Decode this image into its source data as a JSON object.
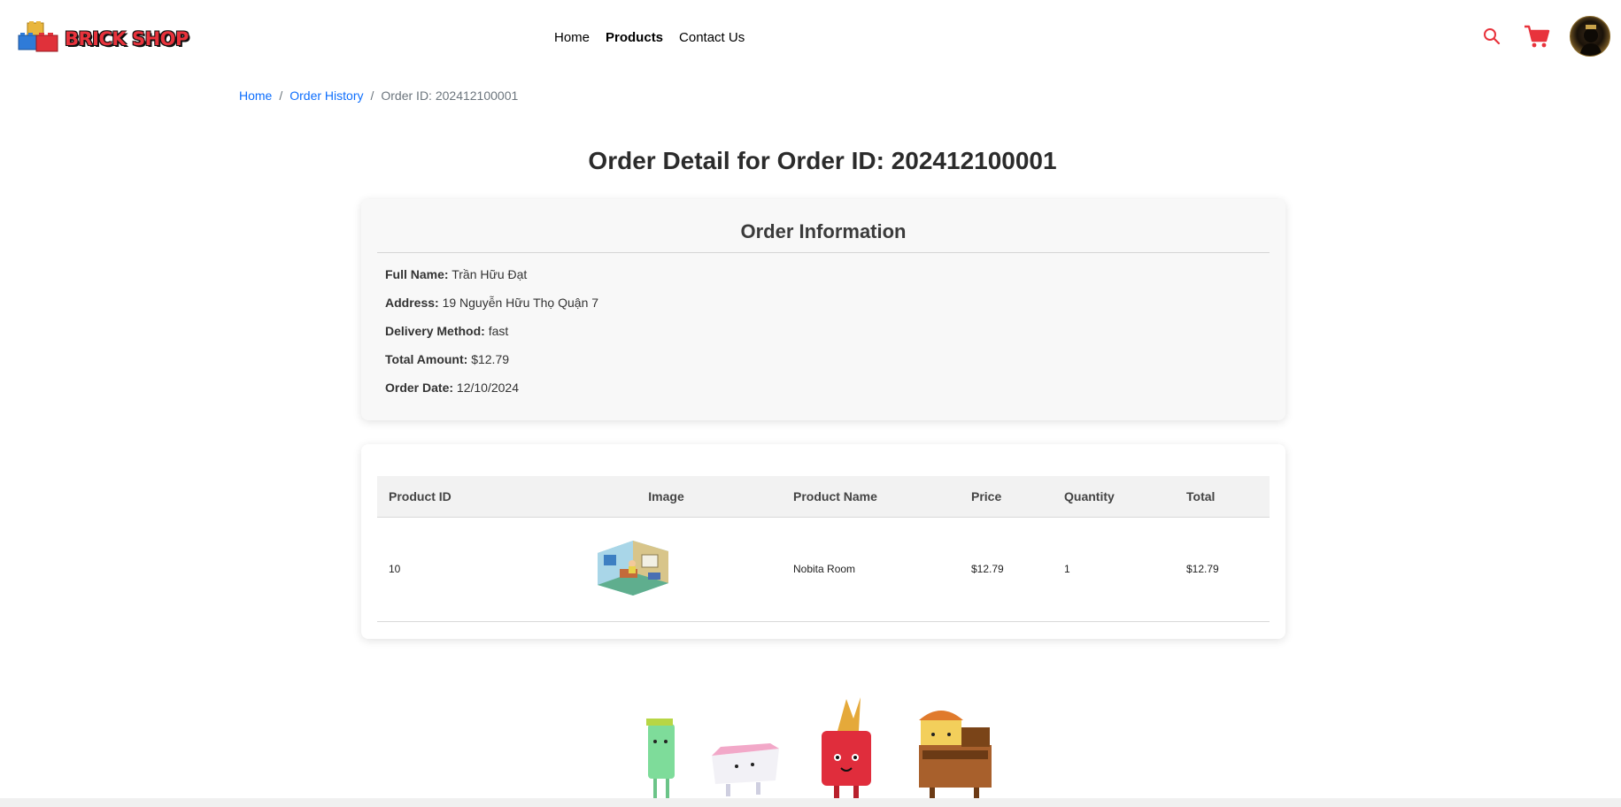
{
  "header": {
    "logo_text": "BRICK SHOP",
    "nav": [
      {
        "label": "Home",
        "active": false
      },
      {
        "label": "Products",
        "active": true
      },
      {
        "label": "Contact Us",
        "active": false
      }
    ],
    "icons": [
      "search-icon",
      "cart-icon",
      "avatar"
    ],
    "accent_color": "#e8333c"
  },
  "breadcrumb": {
    "home": "Home",
    "order_history": "Order History",
    "current": "Order ID: 202412100001",
    "separator": "/"
  },
  "page_title": "Order Detail for Order ID: 202412100001",
  "order_info": {
    "title": "Order Information",
    "full_name_label": "Full Name:",
    "full_name": "Trần Hữu Đạt",
    "address_label": "Address:",
    "address": "19 Nguyễn Hữu Thọ Quận 7",
    "delivery_label": "Delivery Method:",
    "delivery": "fast",
    "total_label": "Total Amount:",
    "total": "$12.79",
    "date_label": "Order Date:",
    "date": "12/10/2024"
  },
  "products_table": {
    "headers": [
      "Product ID",
      "Image",
      "Product Name",
      "Price",
      "Quantity",
      "Total"
    ],
    "rows": [
      {
        "product_id": "10",
        "image": "nobita-room-thumbnail",
        "name": "Nobita Room",
        "price": "$12.79",
        "quantity": "1",
        "total": "$12.79"
      }
    ]
  }
}
